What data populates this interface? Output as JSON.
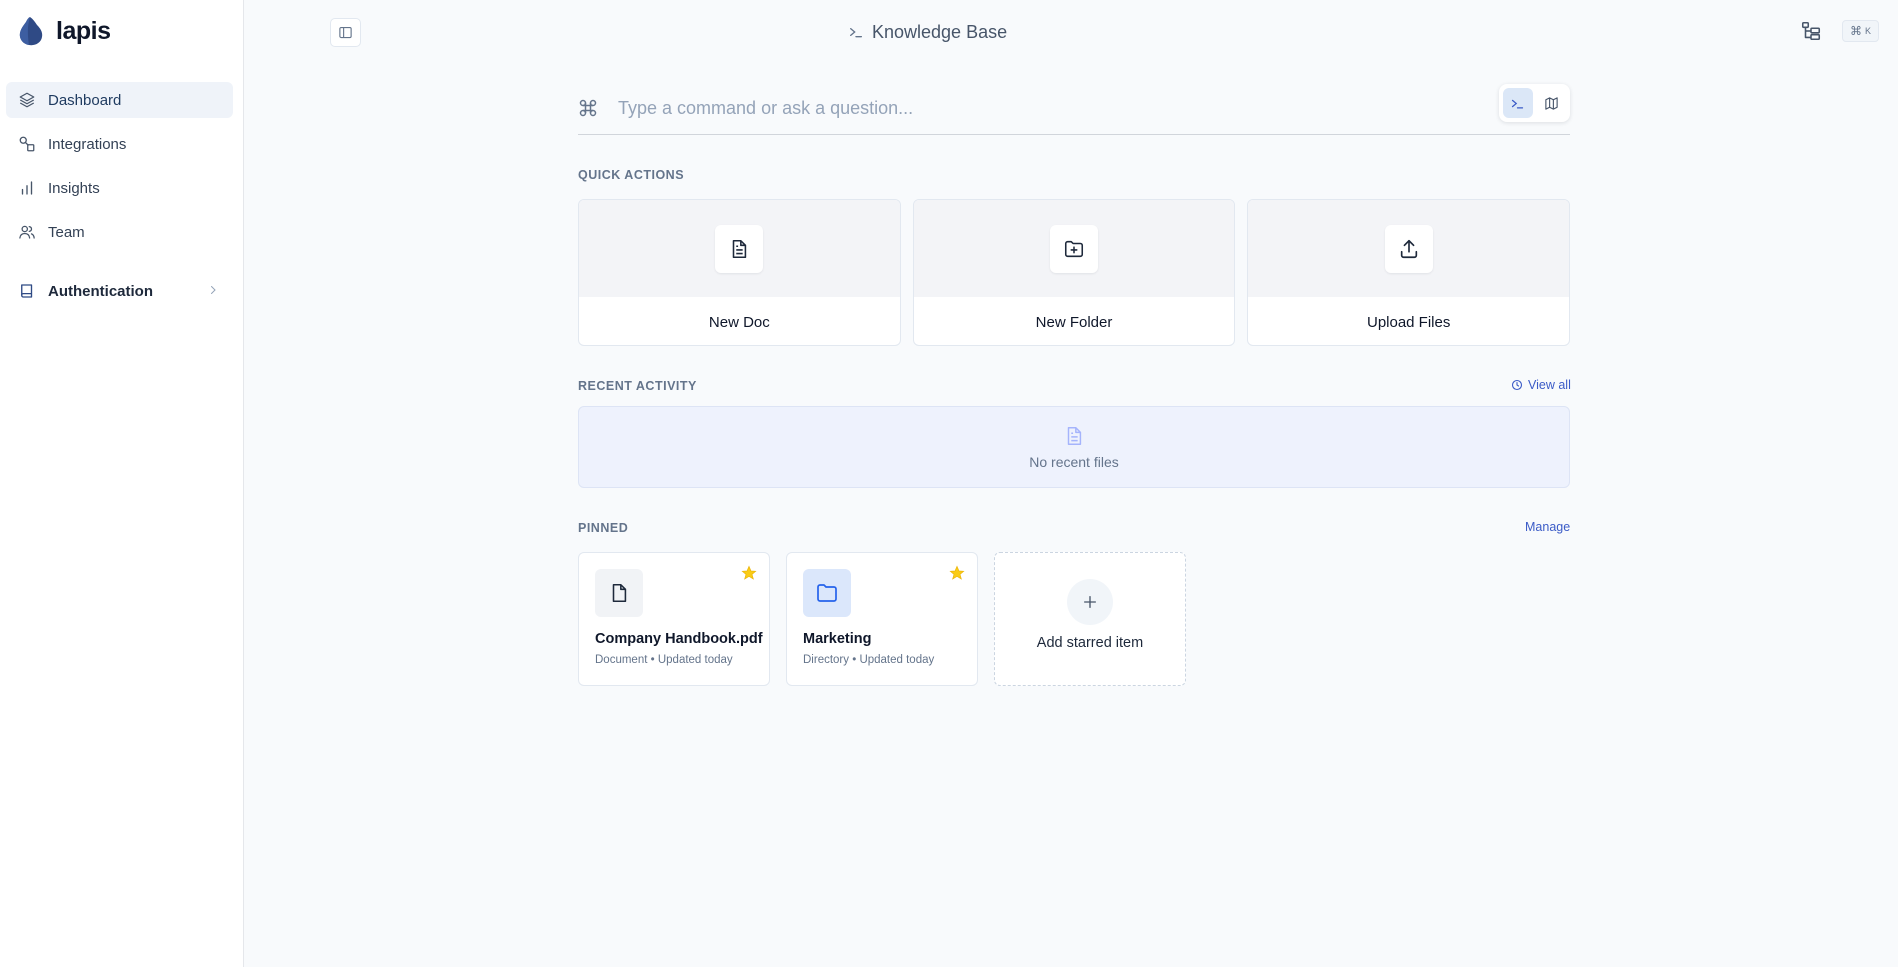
{
  "app": {
    "name": "lapis"
  },
  "sidebar": {
    "items": [
      {
        "label": "Dashboard",
        "icon": "layers-icon"
      },
      {
        "label": "Integrations",
        "icon": "shapes-icon"
      },
      {
        "label": "Insights",
        "icon": "bar-chart-icon"
      },
      {
        "label": "Team",
        "icon": "users-icon"
      }
    ],
    "groups": [
      {
        "label": "Authentication",
        "icon": "book-icon"
      }
    ]
  },
  "header": {
    "title": "Knowledge Base",
    "shortcut_symbol": "⌘",
    "shortcut_key": "K"
  },
  "command": {
    "placeholder": "Type a command or ask a question..."
  },
  "quick_actions": {
    "label": "QUICK ACTIONS",
    "items": [
      {
        "label": "New Doc",
        "icon": "file-text-icon"
      },
      {
        "label": "New Folder",
        "icon": "folder-plus-icon"
      },
      {
        "label": "Upload Files",
        "icon": "upload-icon"
      }
    ]
  },
  "recent": {
    "label": "RECENT ACTIVITY",
    "view_all": "View all",
    "empty": "No recent files"
  },
  "pinned": {
    "label": "PINNED",
    "manage": "Manage",
    "items": [
      {
        "title": "Company Handbook.pdf",
        "type": "Document",
        "updated": "Updated today",
        "icon": "file-icon"
      },
      {
        "title": "Marketing",
        "type": "Directory",
        "updated": "Updated today",
        "icon": "folder-icon"
      }
    ],
    "add_label": "Add starred item"
  },
  "colors": {
    "accent": "#3b5bc7",
    "star": "#facc15",
    "active_nav": "#eff3f9"
  }
}
